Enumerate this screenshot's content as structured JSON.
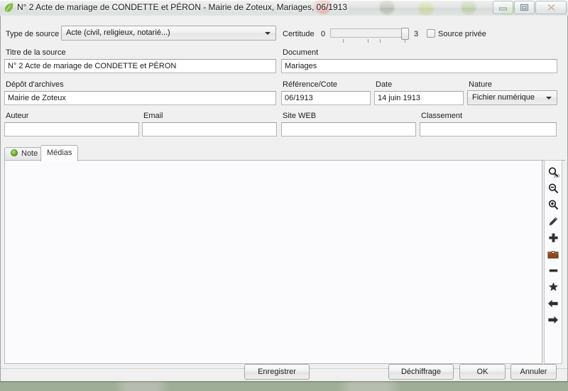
{
  "window": {
    "title": "N° 2 Acte de mariage de CONDETTE et PÉRON - Mairie de Zoteux, Mariages, 06/1913",
    "app_icon": "leaf-icon",
    "controls": {
      "minimize": "minimize-icon",
      "restore": "restore-icon",
      "close": "close-icon"
    }
  },
  "form": {
    "source_type": {
      "label": "Type de source",
      "value": "Acte (civil, religieux, notarié...)"
    },
    "certitude": {
      "label": "Certitude",
      "min_label": "0",
      "max_label": "3",
      "min": 0,
      "max": 3,
      "value": 3
    },
    "private_source": {
      "label": "Source privée",
      "checked": false
    },
    "title": {
      "label": "Titre de la source",
      "value": "N° 2 Acte de mariage de CONDETTE et PÉRON",
      "placeholder": ""
    },
    "document": {
      "label": "Document",
      "value": "Mariages",
      "placeholder": ""
    },
    "archive": {
      "label": "Dépôt d'archives",
      "value": "Mairie de Zoteux",
      "placeholder": ""
    },
    "reference": {
      "label": "Référence/Cote",
      "value": "06/1913",
      "placeholder": ""
    },
    "date": {
      "label": "Date",
      "value": "14 juin 1913",
      "placeholder": ""
    },
    "nature": {
      "label": "Nature",
      "value": "Fichier numérique"
    },
    "author": {
      "label": "Auteur",
      "value": "",
      "placeholder": ""
    },
    "email": {
      "label": "Email",
      "value": "",
      "placeholder": ""
    },
    "website": {
      "label": "Site WEB",
      "value": "",
      "placeholder": ""
    },
    "classification": {
      "label": "Classement",
      "value": "",
      "placeholder": ""
    }
  },
  "tabs": [
    {
      "label": "Note",
      "icon": "green-dot-icon",
      "active": false
    },
    {
      "label": "Médias",
      "icon": "",
      "active": true
    }
  ],
  "media_tools": [
    {
      "name": "zoom-fit-icon"
    },
    {
      "name": "zoom-out-icon"
    },
    {
      "name": "zoom-in-icon"
    },
    {
      "name": "edit-pencil-icon"
    },
    {
      "name": "add-plus-icon"
    },
    {
      "name": "archive-box-icon"
    },
    {
      "name": "remove-minus-icon"
    },
    {
      "name": "star-icon"
    },
    {
      "name": "arrow-left-icon"
    },
    {
      "name": "arrow-right-icon"
    }
  ],
  "footer": {
    "save": "Enregistrer",
    "decipher": "Déchiffrage",
    "ok": "OK",
    "cancel": "Annuler"
  },
  "colors": {
    "window_bg": "#f0f0f0",
    "panel_bg": "#fbfbfd",
    "field_bg": "#ffffff",
    "border": "#b4b4b4",
    "text": "#1a1a1a",
    "tab_active_bg": "#fdfdfd",
    "status_dot": "#5d9c20",
    "archive_icon": "#8a4b22"
  }
}
